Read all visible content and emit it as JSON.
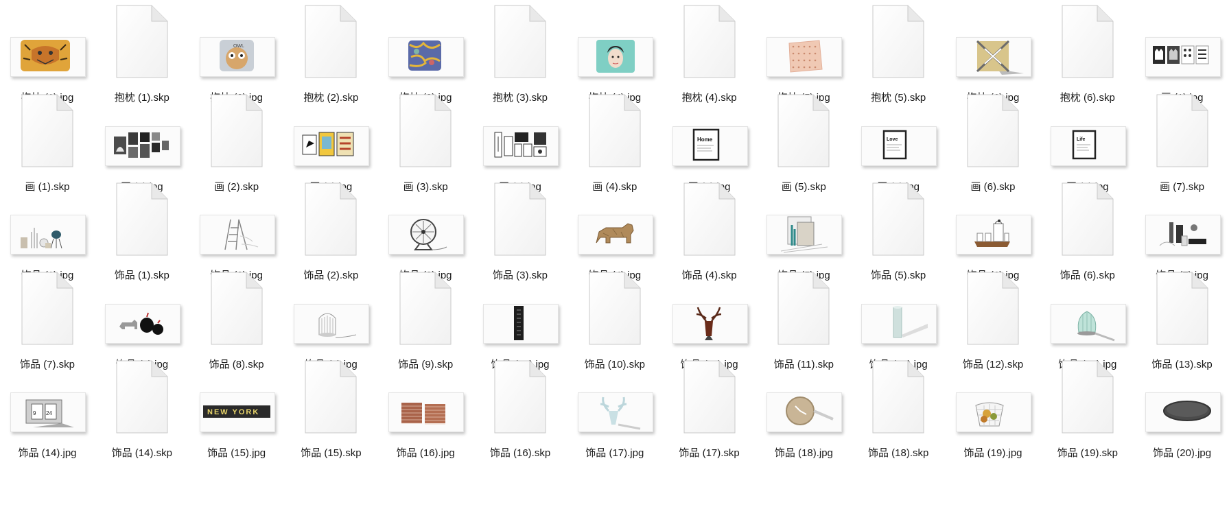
{
  "files": [
    {
      "name": "抱枕 (1).jpg",
      "kind": "image",
      "icon": "tiger-pillow-thumbnail"
    },
    {
      "name": "抱枕 (1).skp",
      "kind": "document",
      "icon": "blank-document-icon"
    },
    {
      "name": "抱枕 (2).jpg",
      "kind": "image",
      "icon": "owl-pillow-thumbnail"
    },
    {
      "name": "抱枕 (2).skp",
      "kind": "document",
      "icon": "blank-document-icon"
    },
    {
      "name": "抱枕 (3).jpg",
      "kind": "image",
      "icon": "patterned-pillow-thumbnail"
    },
    {
      "name": "抱枕 (3).skp",
      "kind": "document",
      "icon": "blank-document-icon"
    },
    {
      "name": "抱枕 (4).jpg",
      "kind": "image",
      "icon": "portrait-pillow-thumbnail"
    },
    {
      "name": "抱枕 (4).skp",
      "kind": "document",
      "icon": "blank-document-icon"
    },
    {
      "name": "抱枕 (5).jpg",
      "kind": "image",
      "icon": "pink-dotted-pillow-thumbnail"
    },
    {
      "name": "抱枕 (5).skp",
      "kind": "document",
      "icon": "blank-document-icon"
    },
    {
      "name": "抱枕 (6).jpg",
      "kind": "image",
      "icon": "geometric-pillow-thumbnail"
    },
    {
      "name": "抱枕 (6).skp",
      "kind": "document",
      "icon": "blank-document-icon"
    },
    {
      "name": "画 (1).jpg",
      "kind": "image",
      "icon": "cat-prints-thumbnail"
    },
    {
      "name": "画 (1).skp",
      "kind": "document",
      "icon": "blank-document-icon"
    },
    {
      "name": "画 (2).jpg",
      "kind": "image",
      "icon": "dark-frames-thumbnail"
    },
    {
      "name": "画 (2).skp",
      "kind": "document",
      "icon": "blank-document-icon"
    },
    {
      "name": "画 (3).jpg",
      "kind": "image",
      "icon": "colorful-frames-thumbnail"
    },
    {
      "name": "画 (3).skp",
      "kind": "document",
      "icon": "blank-document-icon"
    },
    {
      "name": "画 (4).jpg",
      "kind": "image",
      "icon": "gallery-wall-thumbnail"
    },
    {
      "name": "画 (4).skp",
      "kind": "document",
      "icon": "blank-document-icon"
    },
    {
      "name": "画 (5).jpg",
      "kind": "image",
      "icon": "home-frame-thumbnail",
      "caption": "Home"
    },
    {
      "name": "画 (5).skp",
      "kind": "document",
      "icon": "blank-document-icon"
    },
    {
      "name": "画 (6).jpg",
      "kind": "image",
      "icon": "love-frame-thumbnail",
      "caption": "Love"
    },
    {
      "name": "画 (6).skp",
      "kind": "document",
      "icon": "blank-document-icon"
    },
    {
      "name": "画 (7).jpg",
      "kind": "image",
      "icon": "life-frame-thumbnail",
      "caption": "Life"
    },
    {
      "name": "画 (7).skp",
      "kind": "document",
      "icon": "blank-document-icon"
    },
    {
      "name": "饰品 (1).jpg",
      "kind": "image",
      "icon": "decor-set-thumbnail"
    },
    {
      "name": "饰品 (1).skp",
      "kind": "document",
      "icon": "blank-document-icon"
    },
    {
      "name": "饰品 (2).jpg",
      "kind": "image",
      "icon": "ladder-thumbnail"
    },
    {
      "name": "饰品 (2).skp",
      "kind": "document",
      "icon": "blank-document-icon"
    },
    {
      "name": "饰品 (3).jpg",
      "kind": "image",
      "icon": "fan-thumbnail"
    },
    {
      "name": "饰品 (3).skp",
      "kind": "document",
      "icon": "blank-document-icon"
    },
    {
      "name": "饰品 (4).jpg",
      "kind": "image",
      "icon": "wooden-bear-thumbnail"
    },
    {
      "name": "饰品 (4).skp",
      "kind": "document",
      "icon": "blank-document-icon"
    },
    {
      "name": "饰品 (5).jpg",
      "kind": "image",
      "icon": "frames-set-thumbnail"
    },
    {
      "name": "饰品 (5).skp",
      "kind": "document",
      "icon": "blank-document-icon"
    },
    {
      "name": "饰品 (6).jpg",
      "kind": "image",
      "icon": "tea-set-thumbnail"
    },
    {
      "name": "饰品 (6).skp",
      "kind": "document",
      "icon": "blank-document-icon"
    },
    {
      "name": "饰品 (7).jpg",
      "kind": "image",
      "icon": "desk-items-thumbnail"
    },
    {
      "name": "饰品 (7).skp",
      "kind": "document",
      "icon": "blank-document-icon"
    },
    {
      "name": "饰品 (8).jpg",
      "kind": "image",
      "icon": "animal-figurines-thumbnail"
    },
    {
      "name": "饰品 (8).skp",
      "kind": "document",
      "icon": "blank-document-icon"
    },
    {
      "name": "饰品 (9).jpg",
      "kind": "image",
      "icon": "birdcage-thumbnail"
    },
    {
      "name": "饰品 (9).skp",
      "kind": "document",
      "icon": "blank-document-icon"
    },
    {
      "name": "饰品 (10).jpg",
      "kind": "image",
      "icon": "black-panel-thumbnail"
    },
    {
      "name": "饰品 (10).skp",
      "kind": "document",
      "icon": "blank-document-icon"
    },
    {
      "name": "饰品 (11).jpg",
      "kind": "image",
      "icon": "deer-head-thumbnail"
    },
    {
      "name": "饰品 (11).skp",
      "kind": "document",
      "icon": "blank-document-icon"
    },
    {
      "name": "饰品 (12).jpg",
      "kind": "image",
      "icon": "cylinder-vase-thumbnail"
    },
    {
      "name": "饰品 (12).skp",
      "kind": "document",
      "icon": "blank-document-icon"
    },
    {
      "name": "饰品 (13).jpg",
      "kind": "image",
      "icon": "glass-lamp-thumbnail"
    },
    {
      "name": "饰品 (13).skp",
      "kind": "document",
      "icon": "blank-document-icon"
    },
    {
      "name": "饰品 (14).jpg",
      "kind": "image",
      "icon": "flip-clock-thumbnail",
      "caption": "9 24"
    },
    {
      "name": "饰品 (14).skp",
      "kind": "document",
      "icon": "blank-document-icon"
    },
    {
      "name": "饰品 (15).jpg",
      "kind": "image",
      "icon": "new-york-sign-thumbnail",
      "caption": "NEW YORK"
    },
    {
      "name": "饰品 (15).skp",
      "kind": "document",
      "icon": "blank-document-icon"
    },
    {
      "name": "饰品 (16).jpg",
      "kind": "image",
      "icon": "brick-boxes-thumbnail"
    },
    {
      "name": "饰品 (16).skp",
      "kind": "document",
      "icon": "blank-document-icon"
    },
    {
      "name": "饰品 (17).jpg",
      "kind": "image",
      "icon": "antler-sculpture-thumbnail"
    },
    {
      "name": "饰品 (17).skp",
      "kind": "document",
      "icon": "blank-document-icon"
    },
    {
      "name": "饰品 (18).jpg",
      "kind": "image",
      "icon": "wall-clock-thumbnail"
    },
    {
      "name": "饰品 (18).skp",
      "kind": "document",
      "icon": "blank-document-icon"
    },
    {
      "name": "饰品 (19).jpg",
      "kind": "image",
      "icon": "fruit-basket-thumbnail"
    },
    {
      "name": "饰品 (19).skp",
      "kind": "document",
      "icon": "blank-document-icon"
    },
    {
      "name": "饰品 (20).jpg",
      "kind": "image",
      "icon": "dark-tray-thumbnail"
    }
  ]
}
